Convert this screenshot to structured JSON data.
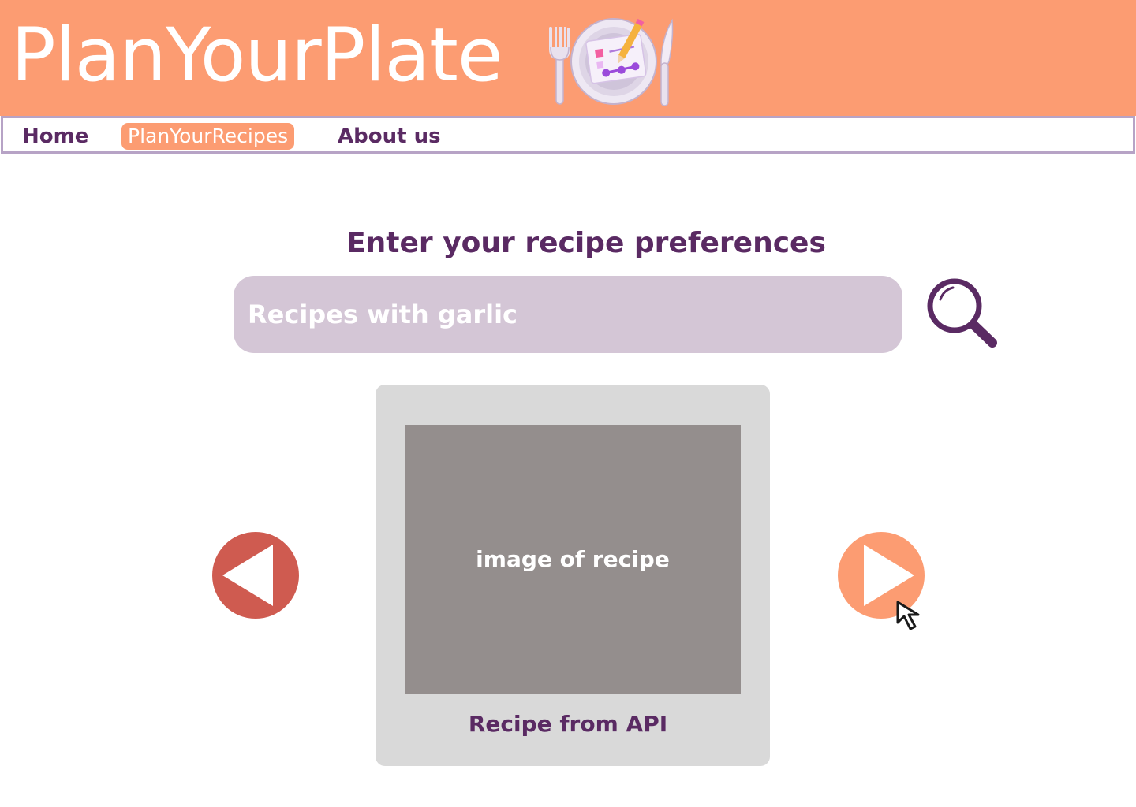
{
  "header": {
    "app_title": "PlanYourPlate",
    "logo_icon": "plate-with-planner-and-cutlery-icon",
    "background_color": "#FC9C72"
  },
  "nav": {
    "items": [
      {
        "label": "Home",
        "active": false
      },
      {
        "label": "PlanYourRecipes",
        "active": true
      },
      {
        "label": "About us",
        "active": false
      }
    ],
    "border_color": "#B7A3C6",
    "text_color": "#5A2A63"
  },
  "search": {
    "heading": "Enter your recipe preferences",
    "placeholder": "Recipes with garlic",
    "value": "",
    "button_icon": "magnifying-glass-icon",
    "field_color": "#D4C6D6"
  },
  "carousel": {
    "prev_icon": "triangle-left-icon",
    "prev_color": "#CF5B50",
    "next_icon": "triangle-right-icon",
    "next_color": "#FC9C72",
    "card": {
      "image_label": "image of recipe",
      "caption": "Recipe from API"
    }
  },
  "pointer": {
    "icon": "mouse-pointer-icon"
  }
}
